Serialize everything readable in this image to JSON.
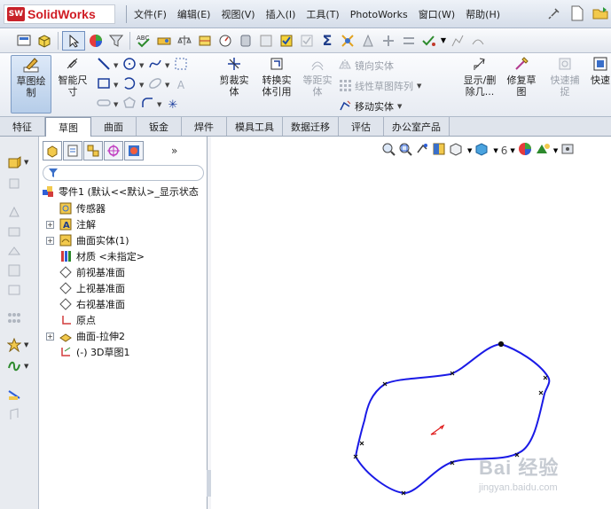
{
  "app": {
    "brand": "SolidWorks",
    "logo_badge": "SW"
  },
  "menu": [
    "文件(F)",
    "编辑(E)",
    "视图(V)",
    "插入(I)",
    "工具(T)",
    "PhotoWorks",
    "窗口(W)",
    "帮助(H)"
  ],
  "commands": {
    "sketch": "草图绘\n制",
    "smart_dimension": "智能尺\n寸",
    "trim": "剪裁实\n体",
    "convert": "转换实\n体引用",
    "offset": "等距实\n体",
    "mirror": "镜向实体",
    "linear_pattern": "线性草图阵列",
    "move": "移动实体",
    "display_delete": "显示/删\n除几...",
    "repair": "修复草\n图",
    "quick_snap": "快速捕\n捉",
    "quick_view": "快速"
  },
  "tabs": [
    "特征",
    "草图",
    "曲面",
    "钣金",
    "焊件",
    "模具工具",
    "数据迁移",
    "评估",
    "办公室产品"
  ],
  "active_tab": "草图",
  "tree": {
    "root": "零件1  (默认<<默认>_显示状态",
    "items": [
      {
        "label": "传感器",
        "expandable": false
      },
      {
        "label": "注解",
        "expandable": true
      },
      {
        "label": "曲面实体(1)",
        "expandable": true
      },
      {
        "label": "材质 <未指定>",
        "expandable": false
      },
      {
        "label": "前视基准面",
        "expandable": false
      },
      {
        "label": "上视基准面",
        "expandable": false
      },
      {
        "label": "右视基准面",
        "expandable": false
      },
      {
        "label": "原点",
        "expandable": false
      },
      {
        "label": "曲面-拉伸2",
        "expandable": true
      },
      {
        "label": "(-) 3D草图1",
        "expandable": false
      }
    ]
  },
  "watermark": {
    "title": "Bai 经验",
    "url": "jingyan.baidu.com"
  },
  "colors": {
    "curve": "#1a1ae6",
    "brand": "#d01c24",
    "axis": "#e02020"
  }
}
